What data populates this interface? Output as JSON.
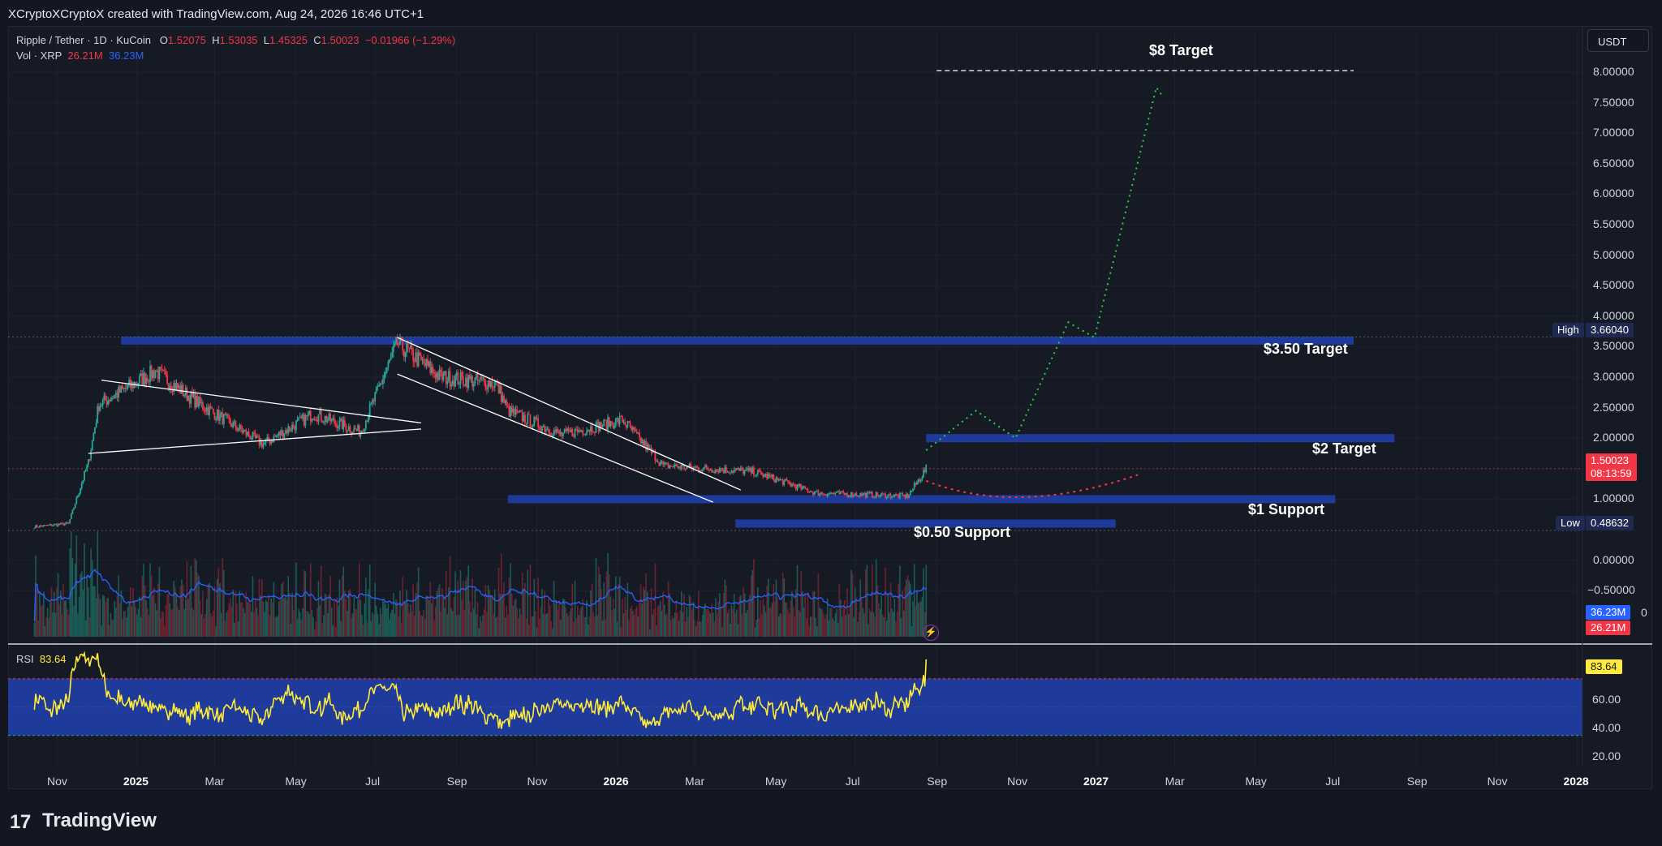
{
  "header": {
    "title": "XCryptoXCryptoX created with TradingView.com, Aug 24, 2026 16:46 UTC+1"
  },
  "legend": {
    "symbol": "Ripple / Tether · 1D · KuCoin",
    "o_label": "O",
    "o_value": "1.52075",
    "h_label": "H",
    "h_value": "1.53035",
    "l_label": "L",
    "l_value": "1.45325",
    "c_label": "C",
    "c_value": "1.50023",
    "change": "−0.01966 (−1.29%)",
    "vol_label": "Vol · XRP",
    "vol_value": "26.21M",
    "vol_ma": "36.23M"
  },
  "currency_button": "USDT",
  "price_axis": {
    "labels": [
      "8.00000",
      "7.50000",
      "7.00000",
      "6.50000",
      "6.00000",
      "5.50000",
      "5.00000",
      "4.50000",
      "4.00000",
      "3.50000",
      "3.00000",
      "2.50000",
      "2.00000",
      "1.00000",
      "0.00000",
      "−0.50000"
    ],
    "high_label": "High",
    "high_value": "3.66040",
    "low_label": "Low",
    "low_value": "0.48632",
    "last_price": "1.50023",
    "countdown": "08:13:59",
    "vol_ma_tag": "36.23M",
    "vol_tag": "26.21M",
    "vol_tag_suffix": "0"
  },
  "rsi": {
    "label": "RSI",
    "value": "83.64",
    "axis": [
      "60.00",
      "40.00",
      "20.00"
    ],
    "tag": "83.64"
  },
  "time_axis": [
    {
      "label": "Nov",
      "bold": false
    },
    {
      "label": "2025",
      "bold": true
    },
    {
      "label": "Mar",
      "bold": false
    },
    {
      "label": "May",
      "bold": false
    },
    {
      "label": "Jul",
      "bold": false
    },
    {
      "label": "Sep",
      "bold": false
    },
    {
      "label": "Nov",
      "bold": false
    },
    {
      "label": "2026",
      "bold": true
    },
    {
      "label": "Mar",
      "bold": false
    },
    {
      "label": "May",
      "bold": false
    },
    {
      "label": "Jul",
      "bold": false
    },
    {
      "label": "Sep",
      "bold": false
    },
    {
      "label": "Nov",
      "bold": false
    },
    {
      "label": "2027",
      "bold": true
    },
    {
      "label": "Mar",
      "bold": false
    },
    {
      "label": "May",
      "bold": false
    },
    {
      "label": "Jul",
      "bold": false
    },
    {
      "label": "Sep",
      "bold": false
    },
    {
      "label": "Nov",
      "bold": false
    },
    {
      "label": "2028",
      "bold": true
    }
  ],
  "annotations": {
    "target_8": "$8 Target",
    "target_350": "$3.50 Target",
    "target_2": "$2 Target",
    "support_1": "$1 Support",
    "support_050": "$0.50 Support"
  },
  "footer": {
    "logo": "17",
    "brand": "TradingView"
  },
  "colors": {
    "background": "#161a25",
    "zone_blue": "#1e3a9a",
    "up": "#26a69a",
    "down": "#f23645",
    "rsi_line": "#ffeb3b",
    "projection_green": "#2ecc40",
    "projection_red": "#f23645",
    "vol_ma": "#2962ff"
  },
  "chart_data": {
    "type": "candlestick",
    "symbol": "XRP/USDT",
    "timeframe": "1D",
    "last": {
      "open": 1.52075,
      "high": 1.53035,
      "low": 1.45325,
      "close": 1.50023
    },
    "period_high": 3.6604,
    "period_low": 0.48632,
    "approx_closes": [
      {
        "date": "2024-10-15",
        "close": 0.55
      },
      {
        "date": "2024-11-10",
        "close": 0.6
      },
      {
        "date": "2024-11-25",
        "close": 1.6
      },
      {
        "date": "2024-12-03",
        "close": 2.55
      },
      {
        "date": "2025-01-15",
        "close": 3.1
      },
      {
        "date": "2025-02-15",
        "close": 2.6
      },
      {
        "date": "2025-04-07",
        "close": 1.9
      },
      {
        "date": "2025-05-15",
        "close": 2.4
      },
      {
        "date": "2025-06-20",
        "close": 2.1
      },
      {
        "date": "2025-07-18",
        "close": 3.55
      },
      {
        "date": "2025-08-20",
        "close": 3.0
      },
      {
        "date": "2025-10-01",
        "close": 2.9
      },
      {
        "date": "2025-10-10",
        "close": 2.45
      },
      {
        "date": "2025-11-20",
        "close": 2.05
      },
      {
        "date": "2026-01-05",
        "close": 2.3
      },
      {
        "date": "2026-02-05",
        "close": 1.55
      },
      {
        "date": "2026-04-15",
        "close": 1.45
      },
      {
        "date": "2026-06-01",
        "close": 1.1
      },
      {
        "date": "2026-08-10",
        "close": 1.05
      },
      {
        "date": "2026-08-24",
        "close": 1.5
      }
    ],
    "zones": [
      {
        "label": "$3.50 Target",
        "price": 3.6
      },
      {
        "label": "$2 Target",
        "price": 2.0
      },
      {
        "label": "$1 Support",
        "price": 1.0
      },
      {
        "label": "$0.50 Support",
        "price": 0.6
      }
    ],
    "target_line": {
      "label": "$8 Target",
      "price": 8.0
    },
    "projection_bull": [
      {
        "date": "2026-08-24",
        "price": 1.8
      },
      {
        "date": "2026-10-01",
        "price": 2.45
      },
      {
        "date": "2026-10-31",
        "price": 2.0
      },
      {
        "date": "2026-12-10",
        "price": 3.9
      },
      {
        "date": "2026-12-30",
        "price": 3.65
      },
      {
        "date": "2027-02-15",
        "price": 7.75
      },
      {
        "date": "2027-02-20",
        "price": 7.6
      }
    ],
    "projection_bear": [
      {
        "date": "2026-08-24",
        "price": 1.3
      },
      {
        "date": "2026-11-01",
        "price": 1.05
      },
      {
        "date": "2027-02-01",
        "price": 1.4
      }
    ],
    "rsi_last": 83.64,
    "rsi_bands": [
      70,
      30
    ],
    "volume_last": "26.21M",
    "volume_ma_last": "36.23M"
  }
}
